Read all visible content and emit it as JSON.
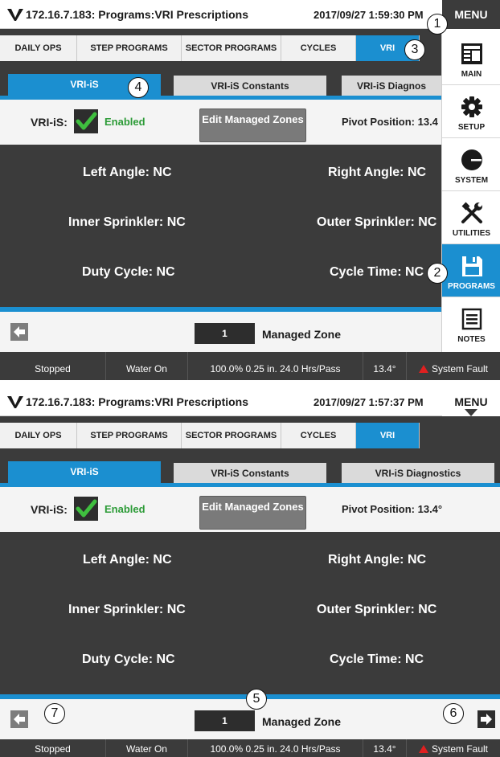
{
  "panels": [
    {
      "title": "172.16.7.183: Programs:VRI Prescriptions",
      "datetime": "2017/09/27 1:59:30 PM",
      "menu_label": "MENU",
      "nav_tabs": [
        "DAILY OPS",
        "STEP PROGRAMS",
        "SECTOR PROGRAMS",
        "CYCLES",
        "VRI"
      ],
      "active_nav_tab": "VRI",
      "sub_tabs": [
        "VRI-iS",
        "VRI-iS Constants",
        "VRI-iS Diagnos"
      ],
      "active_sub_tab": "VRI-iS",
      "vri_label": "VRI-iS:",
      "vri_checked": true,
      "enabled_text": "Enabled",
      "edit_button": "Edit Managed Zones",
      "pivot_position": "Pivot Position: 13.4",
      "values": {
        "left_angle": "Left Angle: NC",
        "right_angle": "Right Angle: NC",
        "inner_sprinkler": "Inner Sprinkler: NC",
        "outer_sprinkler": "Outer Sprinkler: NC",
        "duty_cycle": "Duty Cycle: NC",
        "cycle_time": "Cycle Time: NC"
      },
      "zone_number": "1",
      "zone_label": "Managed Zone",
      "status": {
        "state": "Stopped",
        "water": "Water On",
        "rate": "100.0%  0.25 in.  24.0 Hrs/Pass",
        "angle": "13.4°",
        "fault": "System Fault"
      },
      "side_menu": [
        {
          "label": "MAIN",
          "icon": "main-icon",
          "active": false
        },
        {
          "label": "SETUP",
          "icon": "gear-icon",
          "active": false
        },
        {
          "label": "SYSTEM",
          "icon": "system-icon",
          "active": false
        },
        {
          "label": "UTILITIES",
          "icon": "tools-icon",
          "active": false
        },
        {
          "label": "PROGRAMS",
          "icon": "floppy-icon",
          "active": true
        },
        {
          "label": "NOTES",
          "icon": "notes-icon",
          "active": false
        }
      ],
      "callouts": [
        "1",
        "3",
        "4",
        "2"
      ]
    },
    {
      "title": "172.16.7.183: Programs:VRI Prescriptions",
      "datetime": "2017/09/27 1:57:37 PM",
      "menu_label": "MENU",
      "nav_tabs": [
        "DAILY OPS",
        "STEP PROGRAMS",
        "SECTOR PROGRAMS",
        "CYCLES",
        "VRI"
      ],
      "active_nav_tab": "VRI",
      "sub_tabs": [
        "VRI-iS",
        "VRI-iS Constants",
        "VRI-iS Diagnostics"
      ],
      "active_sub_tab": "VRI-iS",
      "vri_label": "VRI-iS:",
      "vri_checked": true,
      "enabled_text": "Enabled",
      "edit_button": "Edit Managed Zones",
      "pivot_position": "Pivot Position: 13.4°",
      "values": {
        "left_angle": "Left Angle: NC",
        "right_angle": "Right Angle: NC",
        "inner_sprinkler": "Inner Sprinkler: NC",
        "outer_sprinkler": "Outer Sprinkler: NC",
        "duty_cycle": "Duty Cycle: NC",
        "cycle_time": "Cycle Time: NC"
      },
      "zone_number": "1",
      "zone_label": "Managed Zone",
      "status": {
        "state": "Stopped",
        "water": "Water On",
        "rate": "100.0%  0.25 in.  24.0 Hrs/Pass",
        "angle": "13.4°",
        "fault": "System Fault"
      },
      "callouts": [
        "5",
        "7",
        "6"
      ]
    }
  ],
  "colors": {
    "accent": "#1b8fd0",
    "dark": "#3b3b3b",
    "enabled_green": "#2c9b37",
    "fault_red": "#e02020"
  }
}
